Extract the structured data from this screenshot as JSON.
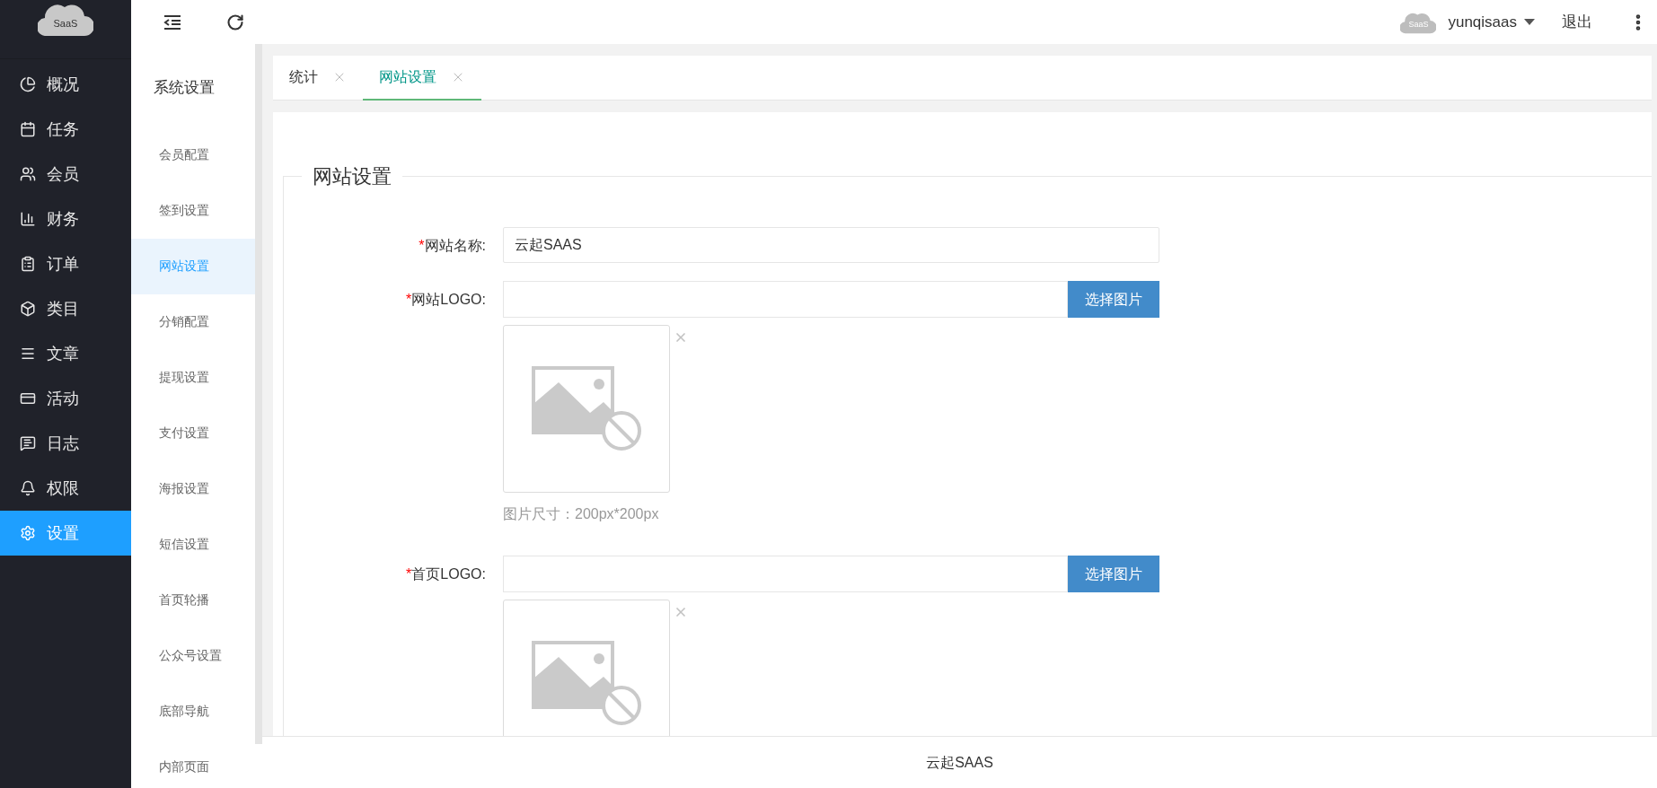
{
  "logo": {
    "text": "SaaS"
  },
  "nav": [
    {
      "label": "概况",
      "selected": false
    },
    {
      "label": "任务",
      "selected": false
    },
    {
      "label": "会员",
      "selected": false
    },
    {
      "label": "财务",
      "selected": false
    },
    {
      "label": "订单",
      "selected": false
    },
    {
      "label": "类目",
      "selected": false
    },
    {
      "label": "文章",
      "selected": false
    },
    {
      "label": "活动",
      "selected": false
    },
    {
      "label": "日志",
      "selected": false
    },
    {
      "label": "权限",
      "selected": false
    },
    {
      "label": "设置",
      "selected": true
    }
  ],
  "header": {
    "avatar_text": "SaaS",
    "user": "yunqisaas",
    "logout": "退出"
  },
  "settings_menu": {
    "title": "系统设置",
    "items": [
      {
        "label": "会员配置",
        "selected": false
      },
      {
        "label": "签到设置",
        "selected": false
      },
      {
        "label": "网站设置",
        "selected": true
      },
      {
        "label": "分销配置",
        "selected": false
      },
      {
        "label": "提现设置",
        "selected": false
      },
      {
        "label": "支付设置",
        "selected": false
      },
      {
        "label": "海报设置",
        "selected": false
      },
      {
        "label": "短信设置",
        "selected": false
      },
      {
        "label": "首页轮播",
        "selected": false
      },
      {
        "label": "公众号设置",
        "selected": false
      },
      {
        "label": "底部导航",
        "selected": false
      },
      {
        "label": "内部页面",
        "selected": false
      }
    ]
  },
  "tabs": [
    {
      "label": "统计",
      "selected": false
    },
    {
      "label": "网站设置",
      "selected": true
    }
  ],
  "form": {
    "legend": "网站设置",
    "fields": [
      {
        "kind": "text",
        "required_mark": "*",
        "label": "网站名称:",
        "value": "云起SAAS"
      },
      {
        "kind": "image",
        "required_mark": "*",
        "label": "网站LOGO:",
        "button": "选择图片",
        "hint": "图片尺寸：200px*200px"
      },
      {
        "kind": "image",
        "required_mark": "*",
        "label": "首页LOGO:",
        "button": "选择图片"
      }
    ]
  },
  "footer": "云起SAAS"
}
